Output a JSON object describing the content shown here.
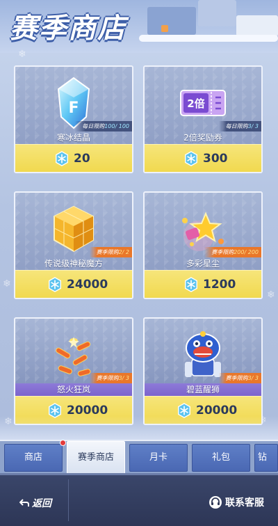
{
  "header": {
    "title": "赛季商店"
  },
  "items": [
    {
      "name": "寒冰结晶",
      "limit_label": "每日限购",
      "limit_value": "100/ 100",
      "price": "20",
      "icon": "ice-crystal-icon",
      "badge_color": "blue"
    },
    {
      "name": "2倍奖励券",
      "limit_label": "每日限购",
      "limit_value": "3/ 3",
      "price": "300",
      "icon": "double-reward-ticket-icon",
      "badge_color": "blue",
      "ticket_text": "2倍"
    },
    {
      "name": "传说级神秘魔方",
      "limit_label": "赛季限购",
      "limit_value": "2/ 2",
      "price": "24000",
      "icon": "golden-cube-icon",
      "badge_color": "orange"
    },
    {
      "name": "多彩星尘",
      "limit_label": "赛季限购",
      "limit_value": "200/ 200",
      "price": "1200",
      "icon": "star-dust-icon",
      "badge_color": "orange"
    },
    {
      "name": "怒火狂岚",
      "limit_label": "赛季限购",
      "limit_value": "3/ 3",
      "price": "20000",
      "icon": "fire-trail-effect-icon",
      "badge_color": "orange"
    },
    {
      "name": "碧蓝醒狮",
      "limit_label": "赛季限购",
      "limit_value": "3/ 3",
      "price": "20000",
      "icon": "blue-lion-costume-icon",
      "badge_color": "orange"
    }
  ],
  "currency_icon": "snowflake-currency-icon",
  "tabs": [
    {
      "label": "商店",
      "active": false,
      "notification": true
    },
    {
      "label": "赛季商店",
      "active": true,
      "notification": false
    },
    {
      "label": "月卡",
      "active": false,
      "notification": false
    },
    {
      "label": "礼包",
      "active": false,
      "notification": false
    },
    {
      "label": "钻",
      "active": false,
      "notification": false
    }
  ],
  "bottom": {
    "back_label": "返回",
    "support_label": "联系客服"
  },
  "colors": {
    "price_bar": "#f1d94f",
    "tab_blue": "#4a68b3",
    "accent_purple": "#7b63cc",
    "limit_orange": "#e9772a"
  }
}
